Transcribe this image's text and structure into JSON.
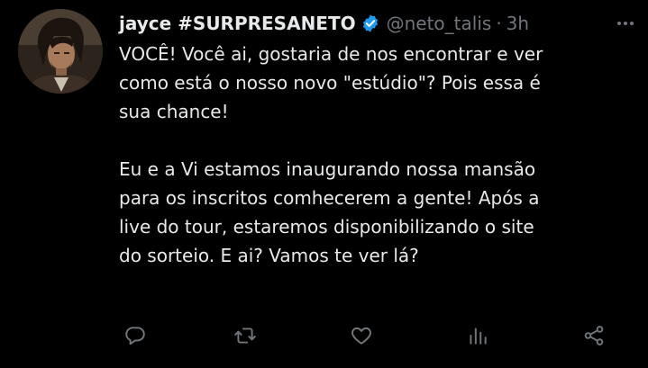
{
  "tweet": {
    "display_name": "jayce #SURPRESANETO",
    "handle": "@neto_talis",
    "separator": "·",
    "time": "3h",
    "paragraphs": [
      "VOCÊ! Você ai, gostaria de nos encontrar e ver\ncomo está o nosso novo \"estúdio\"? Pois essa é\nsua chance!",
      "Eu e a Vi estamos inaugurando nossa mansão\npara os inscritos comhecerem a gente! Após a\nlive do tour, estaremos disponibilizando o site\ndo sorteio. E ai? Vamos te ver lá?"
    ]
  },
  "icons": {
    "verified": "verified-badge-icon",
    "more": "more-options-icon",
    "reply": "reply-icon",
    "retweet": "retweet-icon",
    "like": "like-icon",
    "views": "views-icon",
    "share": "share-icon"
  },
  "colors": {
    "background": "#000000",
    "text": "#e7e9ea",
    "secondary": "#71767b",
    "verified": "#1d9bf0"
  }
}
